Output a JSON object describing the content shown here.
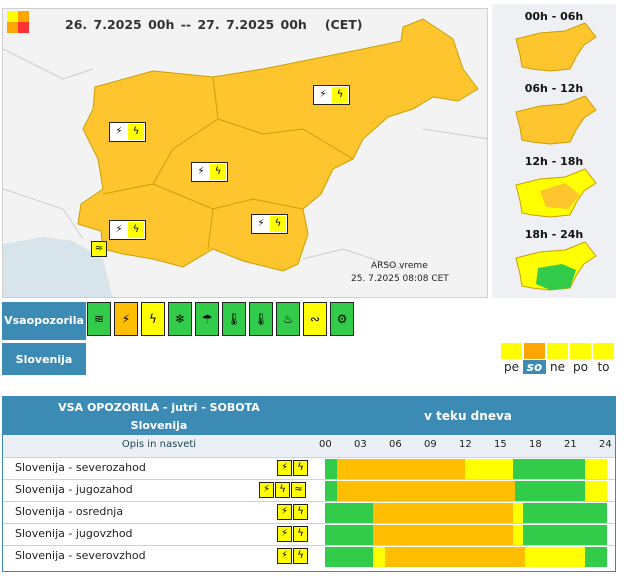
{
  "map": {
    "title_range": "26. 7.2025 00h  --  27. 7.2025 00h",
    "title_tz": "(CET)",
    "credit_line1": "ARSO vreme",
    "credit_line2": "25. 7.2025  08:08 CET"
  },
  "slots": [
    {
      "label": "00h - 06h"
    },
    {
      "label": "06h - 12h"
    },
    {
      "label": "12h - 18h"
    },
    {
      "label": "18h - 24h"
    }
  ],
  "warnings_bar": {
    "label_line1": "Vsa",
    "label_line2": "opozorila"
  },
  "region_bar": {
    "label": "Slovenija"
  },
  "days": [
    {
      "label": "pe",
      "selected": false
    },
    {
      "label": "so",
      "selected": true
    },
    {
      "label": "ne",
      "selected": false
    },
    {
      "label": "po",
      "selected": false
    },
    {
      "label": "to",
      "selected": false
    }
  ],
  "table": {
    "header_line1": "VSA OPOZORILA - jutri - SOBOTA",
    "header_line2": "Slovenija",
    "header_right": "v teku dneva",
    "opis": "Opis in nasveti",
    "hours": [
      "00",
      "03",
      "06",
      "09",
      "12",
      "15",
      "18",
      "21",
      "24"
    ],
    "rows": [
      {
        "name": "Slovenija - severozahod"
      },
      {
        "name": "Slovenija - jugozahod"
      },
      {
        "name": "Slovenija - osrednja"
      },
      {
        "name": "Slovenija - jugovzhod"
      },
      {
        "name": "Slovenija - severovzhod"
      }
    ]
  },
  "colors": {
    "orange": "#ffbf00",
    "yellow": "#ffff00",
    "green": "#33cc4a",
    "blue": "#3c8bb5"
  }
}
